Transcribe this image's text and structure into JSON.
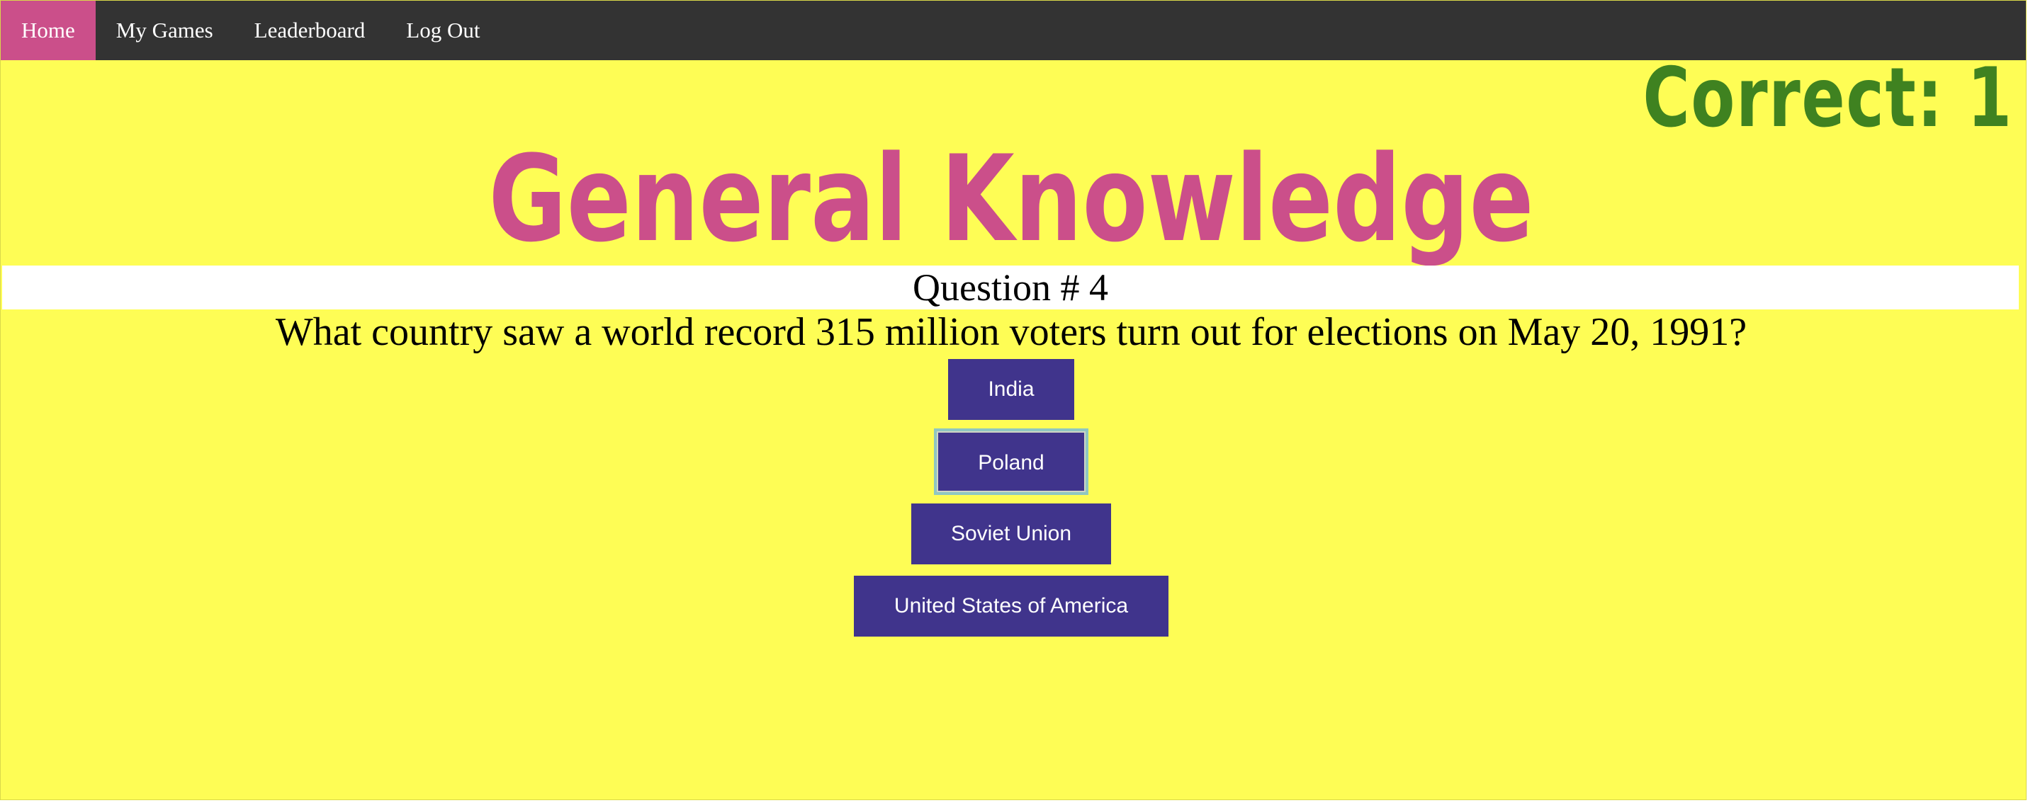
{
  "nav": {
    "items": [
      {
        "label": "Home",
        "active": true
      },
      {
        "label": "My Games",
        "active": false
      },
      {
        "label": "Leaderboard",
        "active": false
      },
      {
        "label": "Log Out",
        "active": false
      }
    ]
  },
  "score": {
    "text": "Correct: 1"
  },
  "quiz": {
    "title": "General Knowledge",
    "question_number": "Question # 4",
    "question": "What country saw a world record 315 million voters turn out for elections on May 20, 1991?",
    "answers": [
      {
        "label": "India"
      },
      {
        "label": "Poland",
        "focused": true
      },
      {
        "label": "Soviet Union"
      },
      {
        "label": "United States of America"
      }
    ]
  },
  "colors": {
    "background": "#fefd55",
    "navbar": "#333333",
    "accent_pink": "#cb4f8a",
    "score_green": "#3f8220",
    "button_purple": "#40348c"
  }
}
